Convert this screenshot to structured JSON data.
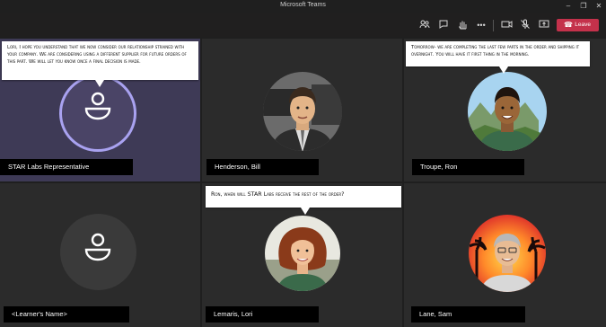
{
  "window": {
    "title": "Microsoft Teams"
  },
  "toolbar": {
    "leave_label": "Leave"
  },
  "participants": [
    {
      "name": "STAR Labs Representative"
    },
    {
      "name": "Henderson, Bill"
    },
    {
      "name": "Troupe, Ron"
    },
    {
      "name": "<Learner's Name>"
    },
    {
      "name": "Lemaris, Lori"
    },
    {
      "name": "Lane, Sam"
    }
  ],
  "bubbles": {
    "star": "Lori, I hope you understand that we now consider our relationship strained with your company. We are considering using a different supplier for future orders of this part. We will let you know once a final decision is made.",
    "troupe": "Tomorrow- we are completing the last few parts in the order and shipping it overnight. You will have it first thing in the morning.",
    "lemaris": "Ron, when will STAR Labs receive the rest of the order?"
  },
  "colors": {
    "active_tile": "#3e3a56",
    "leave_button": "#c4314b",
    "active_ring": "#a9a2f0"
  }
}
